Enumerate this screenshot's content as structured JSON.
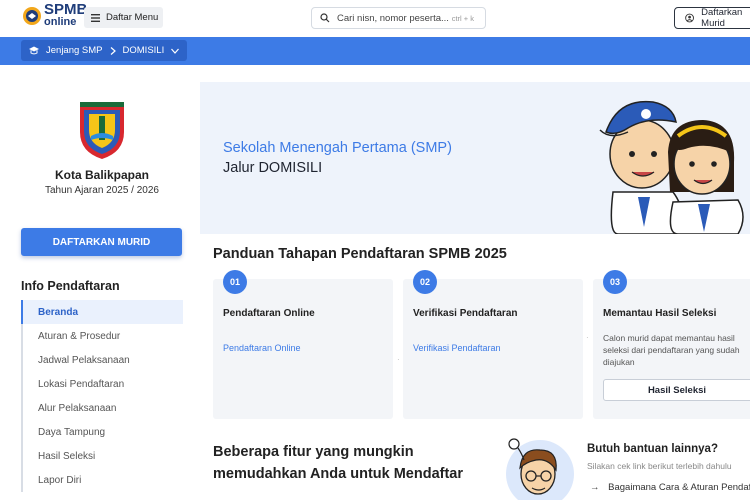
{
  "header": {
    "logo_line1": "SPMB",
    "logo_line2": "online",
    "menu_label": "Daftar Menu",
    "search_placeholder": "Cari nisn, nomor peserta...",
    "search_shortcut": "ctrl + k",
    "register_label": "Daftarkan Murid"
  },
  "breadcrumb": {
    "level": "Jenjang SMP",
    "path": "DOMISILI"
  },
  "sidebar": {
    "city": "Kota Balikpapan",
    "year": "Tahun Ajaran 2025 / 2026",
    "register_button": "DAFTARKAN MURID",
    "info_heading": "Info Pendaftaran",
    "items": [
      {
        "label": "Beranda"
      },
      {
        "label": "Aturan & Prosedur"
      },
      {
        "label": "Jadwal Pelaksanaan"
      },
      {
        "label": "Lokasi Pendaftaran"
      },
      {
        "label": "Alur Pelaksanaan"
      },
      {
        "label": "Daya Tampung"
      },
      {
        "label": "Hasil Seleksi"
      },
      {
        "label": "Lapor Diri"
      }
    ]
  },
  "hero": {
    "line1": "Sekolah Menengah Pertama (SMP)",
    "line2": "Jalur DOMISILI"
  },
  "steps": {
    "heading": "Panduan Tahapan Pendaftaran SPMB 2025",
    "items": [
      {
        "num": "01",
        "title": "Pendaftaran Online",
        "link": "Pendaftaran Online"
      },
      {
        "num": "02",
        "title": "Verifikasi Pendaftaran",
        "link": "Verifikasi Pendaftaran"
      },
      {
        "num": "03",
        "title": "Memantau Hasil Seleksi",
        "desc": "Calon murid dapat memantau hasil seleksi dari pendaftaran yang sudah diajukan",
        "button": "Hasil Seleksi"
      }
    ]
  },
  "features": {
    "heading": "Beberapa fitur yang mungkin memudahkan Anda untuk Mendaftar"
  },
  "help": {
    "heading": "Butuh bantuan lainnya?",
    "subtitle": "Silakan cek link berikut terlebih dahulu",
    "link1": "Bagaimana Cara & Aturan Pendaftaran"
  },
  "colors": {
    "primary": "#3d7be6",
    "primary_dark": "#2d63c8",
    "hero_bg": "#eef3fb",
    "card_bg": "#f3f5f8"
  }
}
